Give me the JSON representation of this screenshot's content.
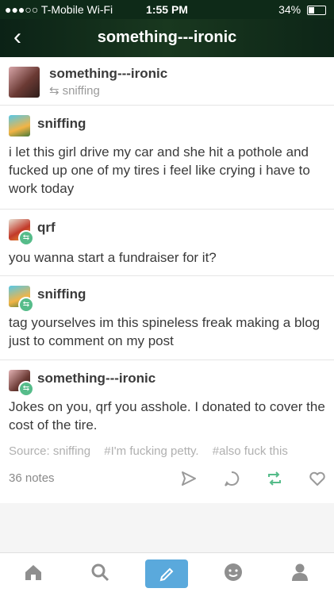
{
  "status": {
    "carrier": "●●●○○ T-Mobile Wi-Fi",
    "time": "1:55 PM",
    "battery": "34%",
    "battery_level": 0.34
  },
  "nav": {
    "title": "something---ironic"
  },
  "post": {
    "blog": "something---ironic",
    "reblogged_from": "sniffing",
    "thread": [
      {
        "user": "sniffing",
        "text": "i let this girl drive my car and she hit a pothole and fucked up one of my tires i feel like crying i have to work today"
      },
      {
        "user": "qrf",
        "text": "you wanna start a fundraiser for it?"
      },
      {
        "user": "sniffing",
        "text": "tag yourselves im this spineless freak making a blog just to comment on my post"
      },
      {
        "user": "something---ironic",
        "text": "Jokes on you, qrf you asshole. I donated to cover the cost of the tire."
      }
    ],
    "source": "Source: sniffing",
    "tags": [
      "#I'm fucking petty.",
      "#also fuck this"
    ],
    "notes": "36 notes"
  },
  "actions": [
    "share-icon",
    "reply-icon",
    "reblog-icon",
    "like-icon"
  ],
  "tabs": [
    "home-icon",
    "search-icon",
    "compose-icon",
    "activity-icon",
    "account-icon"
  ],
  "colors": {
    "accent": "#5aa9dc",
    "reblog": "#56bc8a"
  }
}
